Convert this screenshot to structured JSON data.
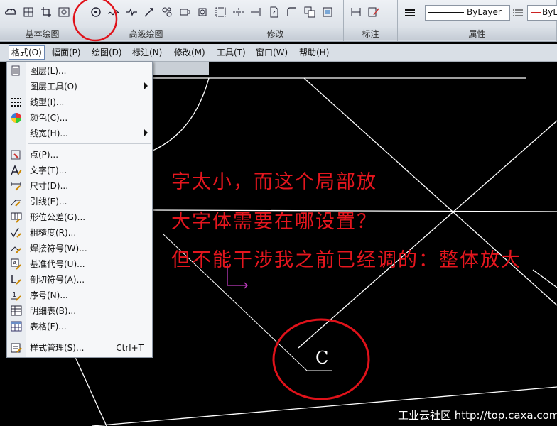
{
  "ribbon": {
    "panels": [
      "基本绘图",
      "高级绘图",
      "修改",
      "标注",
      "属性"
    ],
    "linetype_value": "ByLayer",
    "color_value": "ByL"
  },
  "menubar": {
    "items": [
      "格式(O)",
      "幅面(P)",
      "绘图(D)",
      "标注(N)",
      "修改(M)",
      "工具(T)",
      "窗口(W)",
      "帮助(H)"
    ]
  },
  "format_menu": {
    "items": [
      {
        "label": "图层(L)...",
        "icon": "layers-icon"
      },
      {
        "label": "图层工具(O)",
        "icon": "",
        "submenu": true
      },
      {
        "label": "线型(I)...",
        "icon": "linetype-icon"
      },
      {
        "label": "颜色(C)...",
        "icon": "color-wheel-icon"
      },
      {
        "label": "线宽(H)...",
        "icon": "",
        "submenu": true
      },
      {
        "label": "点(P)...",
        "icon": "point-icon"
      },
      {
        "label": "文字(T)...",
        "icon": "text-icon"
      },
      {
        "label": "尺寸(D)...",
        "icon": "dimension-icon"
      },
      {
        "label": "引线(E)...",
        "icon": "leader-icon"
      },
      {
        "label": "形位公差(G)...",
        "icon": "tolerance-icon"
      },
      {
        "label": "粗糙度(R)...",
        "icon": "roughness-icon"
      },
      {
        "label": "焊接符号(W)...",
        "icon": "weld-icon"
      },
      {
        "label": "基准代号(U)...",
        "icon": "datum-icon"
      },
      {
        "label": "剖切符号(A)...",
        "icon": "section-icon"
      },
      {
        "label": "序号(N)...",
        "icon": "balloon-icon"
      },
      {
        "label": "明细表(B)...",
        "icon": "bom-icon"
      },
      {
        "label": "表格(F)...",
        "icon": "table-icon"
      },
      {
        "label": "样式管理(S)...",
        "icon": "style-manager-icon",
        "shortcut": "Ctrl+T"
      }
    ]
  },
  "drawing": {
    "annotation_lines": [
      "字太小，而这个局部放",
      "大字体需要在哪设置？",
      "但不能干涉我之前已经调的：整体放大"
    ],
    "label_c": "C"
  },
  "watermark": "工业云社区 http://top.caxa.com/",
  "colors": {
    "annotation": "#e5161e",
    "canvas": "#000000",
    "lines": "#ffffff"
  }
}
